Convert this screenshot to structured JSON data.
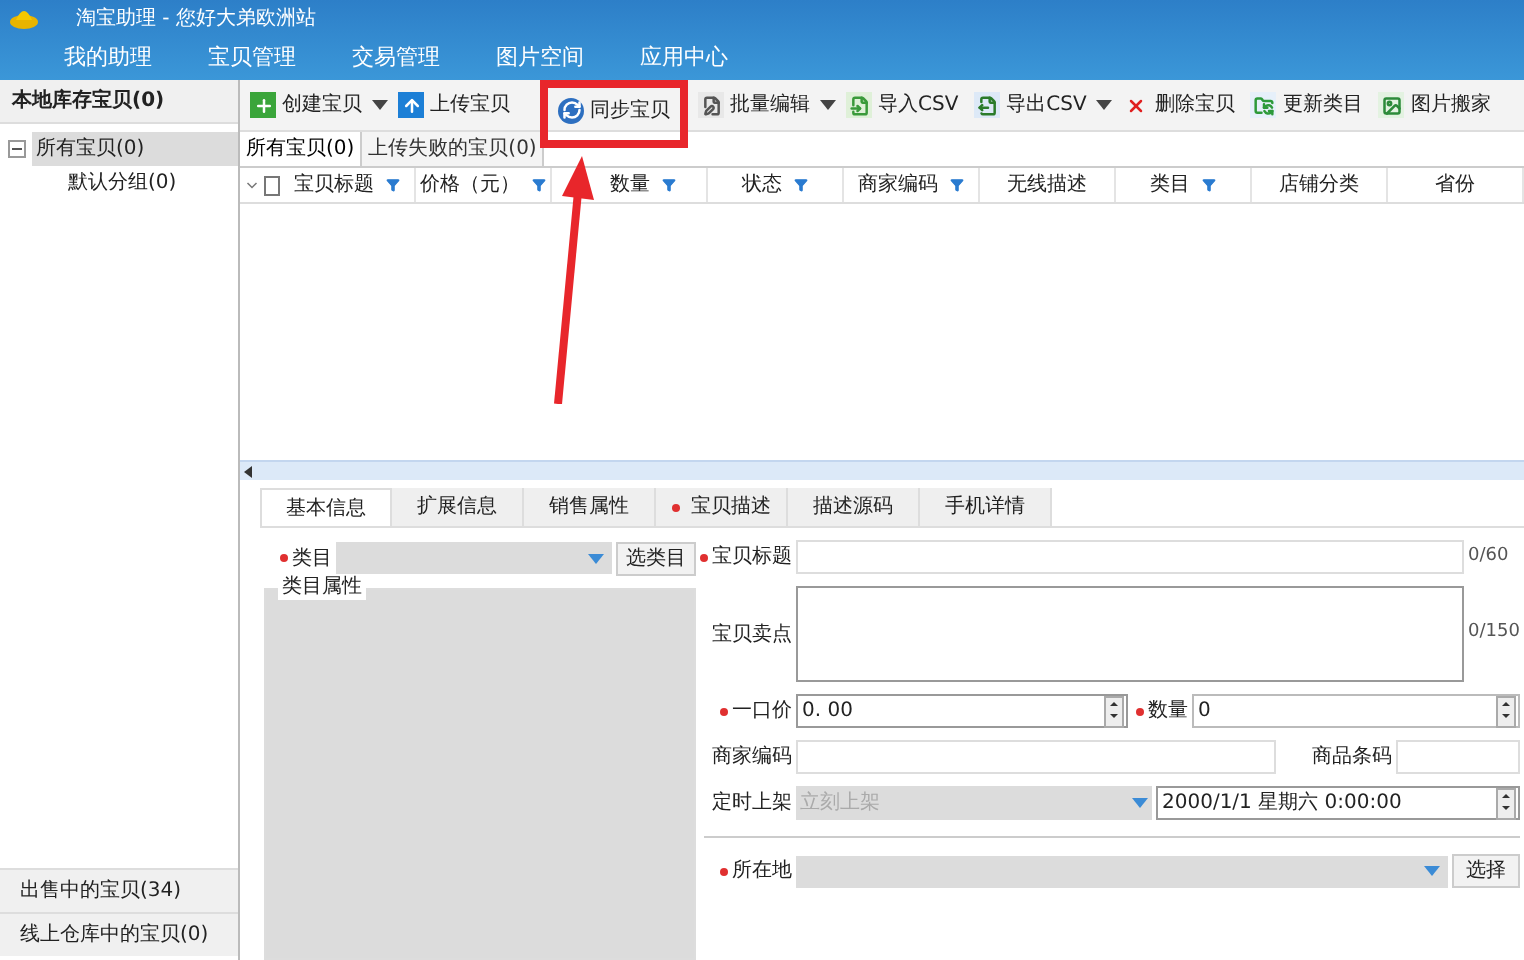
{
  "window": {
    "title": "淘宝助理 - 您好大弟欧洲站"
  },
  "menu": [
    {
      "label": "我的助理"
    },
    {
      "label": "宝贝管理"
    },
    {
      "label": "交易管理"
    },
    {
      "label": "图片空间"
    },
    {
      "label": "应用中心"
    }
  ],
  "sidebar": {
    "header": "本地库存宝贝(0)",
    "tree": [
      {
        "label": "所有宝贝(0)",
        "selected": true,
        "children": [
          {
            "label": "默认分组(0)",
            "selected": false
          }
        ]
      }
    ],
    "bottom_items": [
      {
        "label": "出售中的宝贝(34)"
      },
      {
        "label": "线上仓库中的宝贝(0)"
      }
    ]
  },
  "toolbar": [
    {
      "label": "创建宝贝",
      "kind": "create",
      "dropdown": true,
      "highlighted": false
    },
    {
      "label": "上传宝贝",
      "kind": "upload",
      "dropdown": false,
      "highlighted": false
    },
    {
      "label": "同步宝贝",
      "kind": "sync",
      "dropdown": false,
      "highlighted": true
    },
    {
      "label": "批量编辑",
      "kind": "edit",
      "dropdown": true,
      "highlighted": false
    },
    {
      "label": "导入CSV",
      "kind": "import",
      "dropdown": false,
      "highlighted": false
    },
    {
      "label": "导出CSV",
      "kind": "export",
      "dropdown": true,
      "highlighted": false
    },
    {
      "label": "删除宝贝",
      "kind": "delete",
      "dropdown": false,
      "highlighted": false
    },
    {
      "label": "更新类目",
      "kind": "refresh",
      "dropdown": false,
      "highlighted": false
    },
    {
      "label": "图片搬家",
      "kind": "image",
      "dropdown": false,
      "highlighted": false
    }
  ],
  "list_tabs": [
    {
      "label": "所有宝贝(0)",
      "selected": true
    },
    {
      "label": "上传失败的宝贝(0)",
      "selected": false
    }
  ],
  "table": {
    "select_all": {
      "checked": false
    },
    "columns": [
      {
        "label": "宝贝标题",
        "filter": true
      },
      {
        "label": "价格（元）",
        "filter": true
      },
      {
        "label": "数量",
        "filter": true
      },
      {
        "label": "状态",
        "filter": true
      },
      {
        "label": "商家编码",
        "filter": true
      },
      {
        "label": "无线描述",
        "filter": false
      },
      {
        "label": "类目",
        "filter": true
      },
      {
        "label": "店铺分类",
        "filter": false
      },
      {
        "label": "省份",
        "filter": false
      }
    ]
  },
  "detail_tabs": [
    {
      "label": "基本信息",
      "selected": true,
      "required": false
    },
    {
      "label": "扩展信息",
      "selected": false,
      "required": false
    },
    {
      "label": "销售属性",
      "selected": false,
      "required": false
    },
    {
      "label": "宝贝描述",
      "selected": false,
      "required": true
    },
    {
      "label": "描述源码",
      "selected": false,
      "required": false
    },
    {
      "label": "手机详情",
      "selected": false,
      "required": false
    }
  ],
  "form": {
    "category": {
      "label": "类目",
      "required": true,
      "button": "选类目"
    },
    "attributes_group": "类目属性",
    "title": {
      "label": "宝贝标题",
      "required": true,
      "counter": "0/60"
    },
    "selling_point": {
      "label": "宝贝卖点",
      "required": false,
      "counter": "0/150"
    },
    "price": {
      "label": "一口价",
      "required": true,
      "value": "0. 00"
    },
    "quantity": {
      "label": "数量",
      "required": true,
      "value": "0"
    },
    "merchant_code": {
      "label": "商家编码",
      "required": false
    },
    "barcode": {
      "label": "商品条码",
      "required": false
    },
    "schedule": {
      "label": "定时上架",
      "required": false,
      "value": "立刻上架",
      "disabled": true,
      "datetime": "2000/1/1 星期六 0:00:00"
    },
    "location": {
      "label": "所在地",
      "required": true,
      "button": "选择"
    }
  },
  "annotation": {
    "arrow": true
  }
}
